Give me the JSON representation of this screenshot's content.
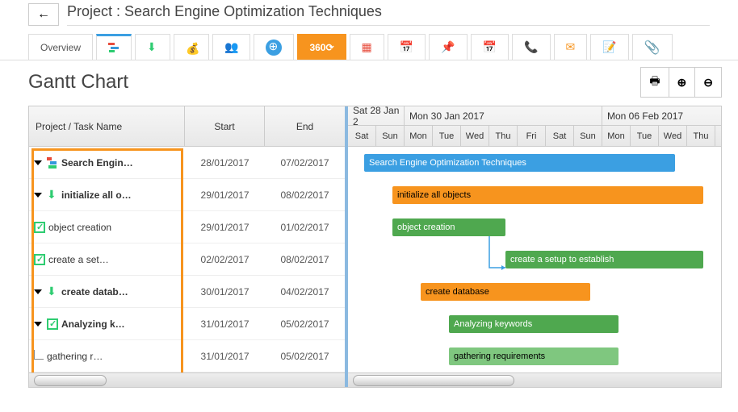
{
  "header": {
    "breadcrumb_prefix": "Project : ",
    "project_name": "Search Engine Optimization Techniques"
  },
  "tabs": {
    "overview": "Overview",
    "three60": "360⟳"
  },
  "chart": {
    "title": "Gantt Chart"
  },
  "grid_headers": {
    "task": "Project / Task Name",
    "start": "Start",
    "end": "End"
  },
  "timeline": {
    "group1": "Sat 28 Jan 2",
    "group2": "Mon 30 Jan 2017",
    "group3": "Mon 06 Feb 2017",
    "days": [
      "Sat",
      "Sun",
      "Mon",
      "Tue",
      "Wed",
      "Thu",
      "Fri",
      "Sat",
      "Sun",
      "Mon",
      "Tue",
      "Wed",
      "Thu"
    ]
  },
  "rows": [
    {
      "name": "Search Engin…",
      "start": "28/01/2017",
      "end": "07/02/2017",
      "bar_label": "Search Engine Optimization Techniques",
      "bar_start": 0,
      "bar_len": 11,
      "color": "blue",
      "indent": 0,
      "bold": true,
      "icon": "struct",
      "triangle": true
    },
    {
      "name": "initialize all o…",
      "start": "29/01/2017",
      "end": "08/02/2017",
      "bar_label": "initialize all objects",
      "bar_start": 1,
      "bar_len": 11,
      "color": "orange",
      "indent": 1,
      "bold": true,
      "icon": "download",
      "triangle": true
    },
    {
      "name": "object creation",
      "start": "29/01/2017",
      "end": "01/02/2017",
      "bar_label": "object creation",
      "bar_start": 1,
      "bar_len": 4,
      "color": "green",
      "indent": 2,
      "bold": false,
      "icon": "check",
      "triangle": false
    },
    {
      "name": "create a set…",
      "start": "02/02/2017",
      "end": "08/02/2017",
      "bar_label": "create a setup to establish",
      "bar_start": 5,
      "bar_len": 7,
      "color": "green",
      "indent": 2,
      "bold": false,
      "icon": "check",
      "triangle": false
    },
    {
      "name": "create datab…",
      "start": "30/01/2017",
      "end": "04/02/2017",
      "bar_label": "create database",
      "bar_start": 2,
      "bar_len": 6,
      "color": "orange",
      "indent": 1,
      "bold": true,
      "icon": "download",
      "triangle": true
    },
    {
      "name": "Analyzing k…",
      "start": "31/01/2017",
      "end": "05/02/2017",
      "bar_label": "Analyzing keywords",
      "bar_start": 3,
      "bar_len": 6,
      "color": "green",
      "indent": 2,
      "bold": true,
      "icon": "check",
      "triangle": true
    },
    {
      "name": "gathering r…",
      "start": "31/01/2017",
      "end": "05/02/2017",
      "bar_label": "gathering requirements",
      "bar_start": 3,
      "bar_len": 6,
      "color": "lgreen",
      "indent": 3,
      "bold": false,
      "icon": "branch",
      "triangle": false
    }
  ],
  "chart_data": {
    "type": "gantt",
    "title": "Gantt Chart",
    "project": "Search Engine Optimization Techniques",
    "date_range": {
      "start": "2017-01-28",
      "end": "2017-02-09"
    },
    "tasks": [
      {
        "id": "root",
        "name": "Search Engine Optimization Techniques",
        "start": "2017-01-28",
        "end": "2017-02-07",
        "type": "project"
      },
      {
        "id": "t1",
        "name": "initialize all objects",
        "start": "2017-01-29",
        "end": "2017-02-08",
        "parent": "root",
        "type": "summary"
      },
      {
        "id": "t1a",
        "name": "object creation",
        "start": "2017-01-29",
        "end": "2017-02-01",
        "parent": "t1",
        "type": "task"
      },
      {
        "id": "t1b",
        "name": "create a setup to establish",
        "start": "2017-02-02",
        "end": "2017-02-08",
        "parent": "t1",
        "type": "task",
        "depends_on": "t1a"
      },
      {
        "id": "t2",
        "name": "create database",
        "start": "2017-01-30",
        "end": "2017-02-04",
        "parent": "root",
        "type": "summary"
      },
      {
        "id": "t2a",
        "name": "Analyzing keywords",
        "start": "2017-01-31",
        "end": "2017-02-05",
        "parent": "t2",
        "type": "summary"
      },
      {
        "id": "t2a1",
        "name": "gathering requirements",
        "start": "2017-01-31",
        "end": "2017-02-05",
        "parent": "t2a",
        "type": "task"
      }
    ]
  }
}
